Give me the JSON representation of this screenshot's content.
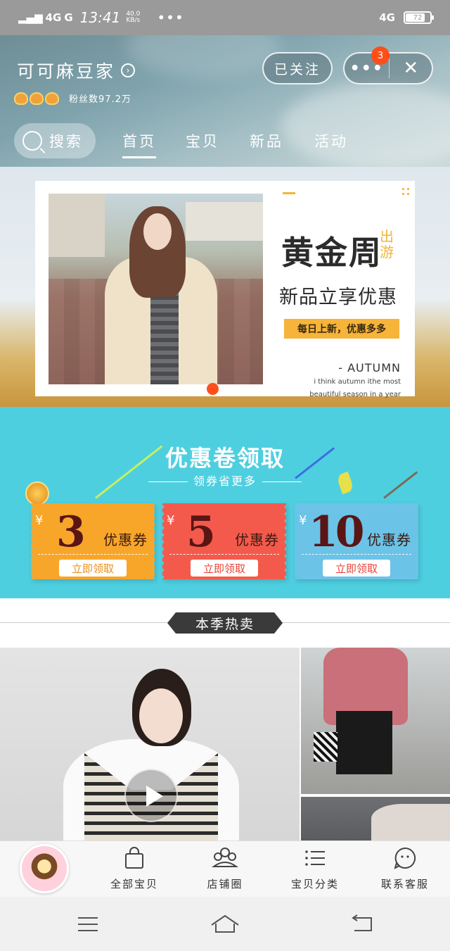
{
  "status_bar": {
    "network1": "4G",
    "network2": "G",
    "time": "13:41",
    "speed_value": "40.0",
    "speed_unit": "KB/s",
    "more": "•••",
    "right_network": "4G",
    "battery": "72"
  },
  "shop": {
    "name": "可可麻豆家",
    "fans": "粉丝数97.2万",
    "follow_label": "已关注",
    "more_label": "•••",
    "close_label": "✕",
    "badge_count": "3"
  },
  "nav": {
    "search_label": "搜索",
    "tabs": [
      "首页",
      "宝贝",
      "新品",
      "活动"
    ],
    "active_tab": "首页"
  },
  "banner": {
    "title": "黄金周",
    "side": "出游",
    "subtitle": "新品立享优惠",
    "tagline": "每日上新，优惠多多",
    "autumn": "- AUTUMN",
    "line1": "i think autumn ithe most",
    "line2": "beautiful season in a year"
  },
  "coupons": {
    "title": "优惠卷领取",
    "subtitle": "领券省更多",
    "items": [
      {
        "currency": "¥",
        "amount": "3",
        "label": "优惠券",
        "action": "立即领取",
        "color": "#f8a62a"
      },
      {
        "currency": "¥",
        "amount": "5",
        "label": "优惠券",
        "action": "立即领取",
        "color": "#f45a4c"
      },
      {
        "currency": "¥",
        "amount": "10",
        "label": "优惠券",
        "action": "立即领取",
        "color": "#6cc3e8"
      }
    ]
  },
  "section": {
    "title": "本季热卖"
  },
  "shop_bar": {
    "items": [
      "全部宝贝",
      "店铺圈",
      "宝贝分类",
      "联系客服"
    ]
  },
  "colors": {
    "accent": "#ff4e1a",
    "coupon_bg": "#4ecfe0"
  }
}
